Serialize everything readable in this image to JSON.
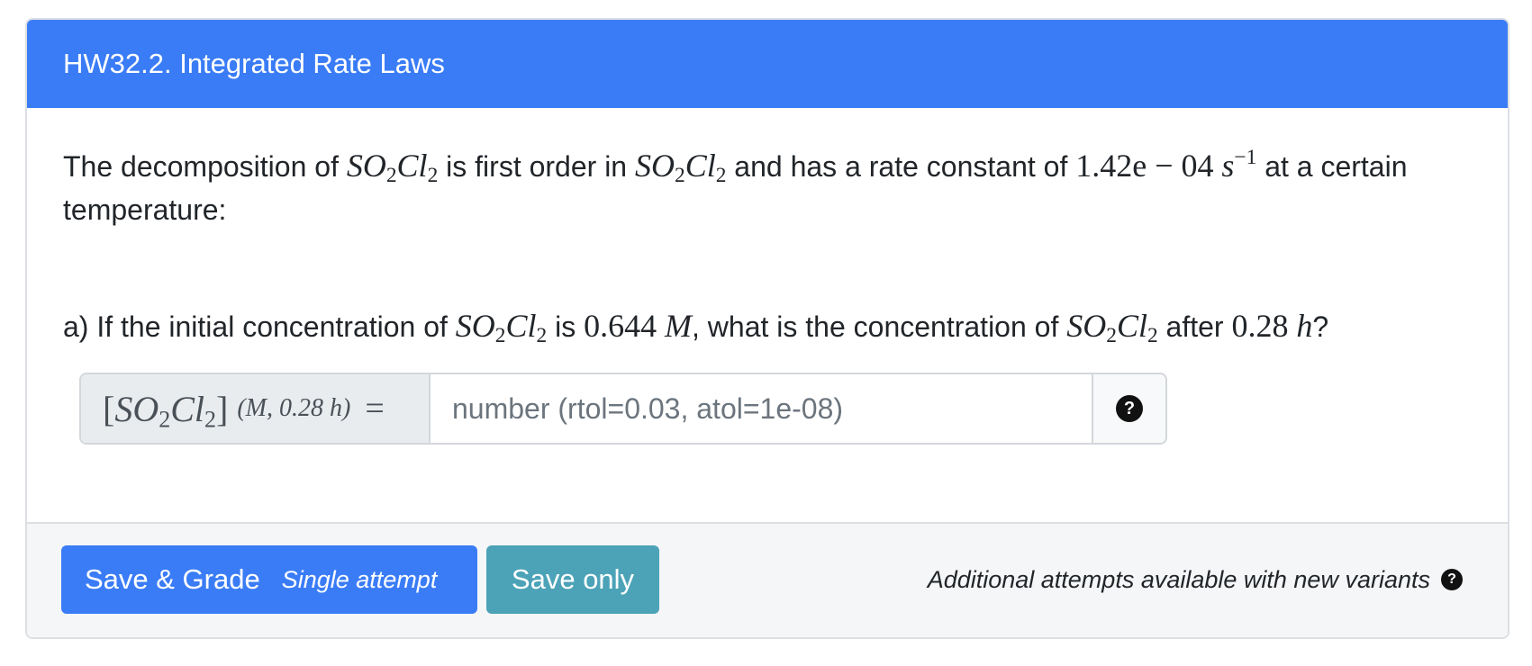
{
  "header": {
    "title": "HW32.2. Integrated Rate Laws"
  },
  "intro": {
    "t1": "The decomposition of ",
    "compound_a": "SO",
    "compound_sub_a": "2",
    "compound_b": "Cl",
    "compound_sub_b": "2",
    "t2": " is first order in ",
    "t3": " and has a rate constant of ",
    "rate_constant": "1.42e − 04",
    "rate_unit": "s",
    "rate_unit_exp": "−1",
    "t4": " at a certain temperature:"
  },
  "question": {
    "t1": "a) If the initial concentration of ",
    "t2": " is ",
    "initial_conc": "0.644",
    "conc_unit": "M",
    "t3": ", what is the concentration of ",
    "t4": " after ",
    "time_value": "0.28",
    "time_unit": "h",
    "t5": "?"
  },
  "answer": {
    "label_open": "[",
    "label_close": "]",
    "label_units": "(M, 0.28 h)",
    "label_eq": "=",
    "placeholder": "number (rtol=0.03, atol=1e-08)",
    "value": "",
    "help_glyph": "?"
  },
  "footer": {
    "save_grade_label": "Save & Grade",
    "single_attempt_label": "Single attempt",
    "save_only_label": "Save only",
    "attempts_note": "Additional attempts available with new variants",
    "help_glyph": "?"
  },
  "colors": {
    "header_bg": "#3a7cf6",
    "primary_button": "#3a7cf6",
    "info_button": "#4ca3b8",
    "footer_bg": "#f5f6f7"
  }
}
